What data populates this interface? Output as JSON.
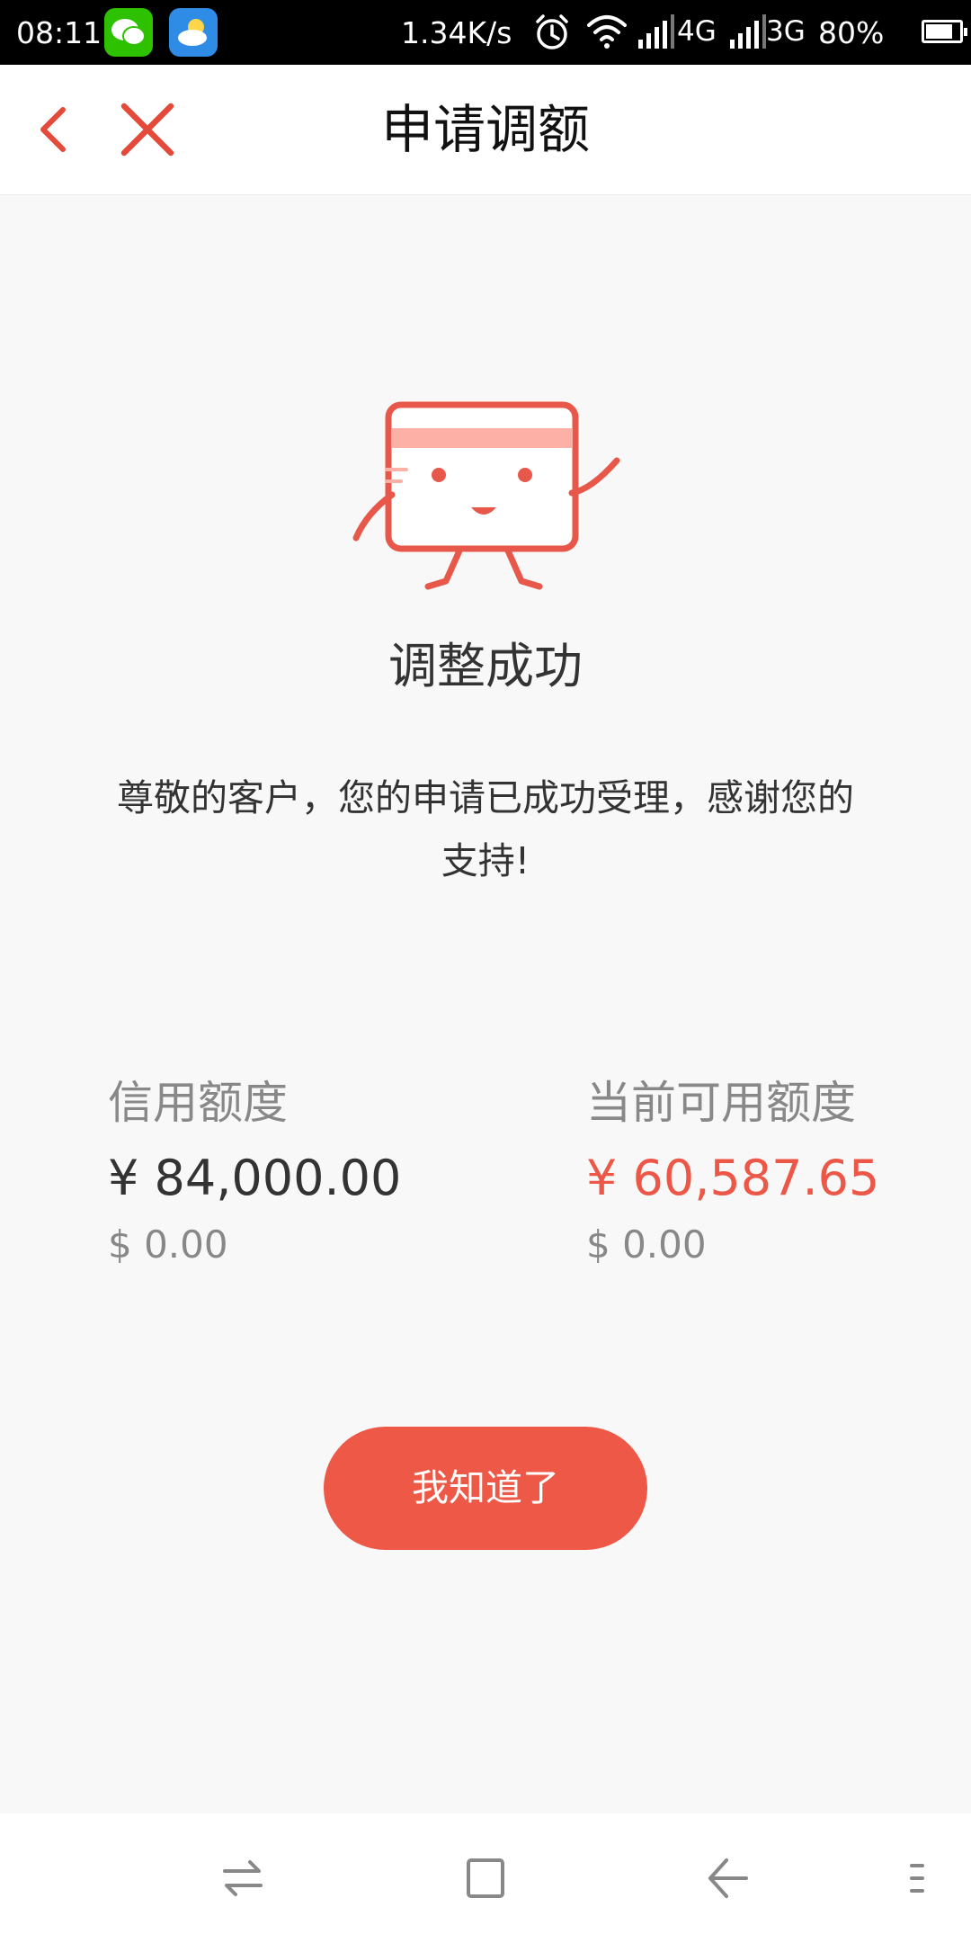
{
  "status_bar": {
    "time": "08:11",
    "network_speed": "1.34K/s",
    "network_1": "4G",
    "network_2": "3G",
    "battery_percent": "80%",
    "battery_level": 0.8,
    "icons": [
      "wechat-icon",
      "weather-icon",
      "alarm-icon",
      "wifi-icon",
      "signal-icon",
      "battery-icon"
    ]
  },
  "header": {
    "title": "申请调额",
    "back_icon": "chevron-left-icon",
    "close_icon": "close-icon"
  },
  "result": {
    "title": "调整成功",
    "message": "尊敬的客户，您的申请已成功受理，感谢您的支持!"
  },
  "credit_limit": {
    "label": "信用额度",
    "amount_cny": "¥ 84,000.00",
    "amount_usd": "$ 0.00"
  },
  "available_limit": {
    "label": "当前可用额度",
    "amount_cny": "¥ 60,587.65",
    "amount_usd": "$ 0.00"
  },
  "confirm_button": {
    "label": "我知道了"
  },
  "nav_bar": {
    "icons": [
      "switch-icon",
      "home-square-icon",
      "back-arrow-icon",
      "menu-icon"
    ]
  },
  "colors": {
    "accent": "#ed5847",
    "amount_red": "#ec5747",
    "background": "#f8f8f8",
    "mascot_light": "#fcb0a6"
  }
}
